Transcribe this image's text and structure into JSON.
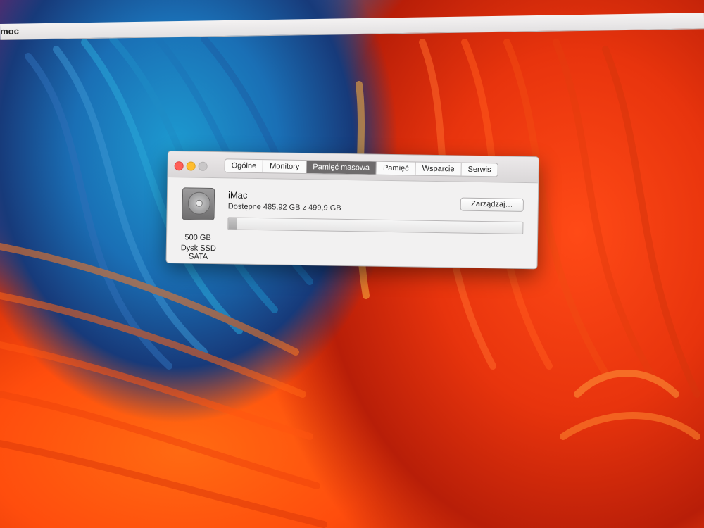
{
  "menubar": {
    "app_label": "moc"
  },
  "window": {
    "tabs": [
      {
        "label": "Ogólne",
        "active": false
      },
      {
        "label": "Monitory",
        "active": false
      },
      {
        "label": "Pamięć masowa",
        "active": true
      },
      {
        "label": "Pamięć",
        "active": false
      },
      {
        "label": "Wsparcie",
        "active": false
      },
      {
        "label": "Serwis",
        "active": false
      }
    ],
    "storage": {
      "disk_icon": "hard-drive-icon",
      "disk_size": "500 GB",
      "disk_type": "Dysk SSD SATA",
      "volume_name": "iMac",
      "available_text": "Dostępne 485,92 GB z 499,9 GB",
      "used_fraction": 0.028,
      "manage_button": "Zarządzaj…"
    }
  },
  "colors": {
    "close": "#ff5f57",
    "minimize": "#ffbd2e",
    "zoom": "#c9c7c8",
    "active_tab": "#6e6b6c"
  }
}
